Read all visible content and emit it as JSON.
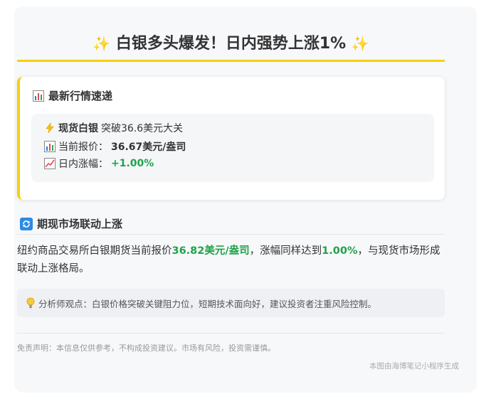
{
  "header": {
    "title": "白银多头爆发！日内强势上涨1%"
  },
  "quote": {
    "heading": "最新行情速递",
    "line1_bold": "现货白银",
    "line1_rest": "突破36.6美元大关",
    "line2_label": "当前报价：",
    "line2_value": "36.67美元/盎司",
    "line3_label": "日内涨幅：",
    "line3_value": "+1.00%"
  },
  "futures": {
    "heading": "期现市场联动上涨",
    "p1": "纽约商品交易所白银期货当前报价",
    "price": "36.82美元/盎司",
    "p2": "，涨幅同样达到",
    "pct": "1.00%",
    "p3": "，与现货市场形成联动上涨格局。"
  },
  "analyst": {
    "text": "分析师观点：白银价格突破关键阻力位，短期技术面向好，建议投资者注重风险控制。"
  },
  "footer": {
    "disclaimer": "免责声明：本信息仅供参考，不构成投资建议。市场有风险，投资需谨慎。",
    "generator": "本图由海博笔记小程序生成"
  },
  "colors": {
    "accent": "#f5d200",
    "positive": "#1fa34a"
  },
  "icons": [
    "sparkles-icon",
    "bar-chart-icon",
    "lightning-icon",
    "trend-up-icon",
    "refresh-icon",
    "lightbulb-icon"
  ]
}
